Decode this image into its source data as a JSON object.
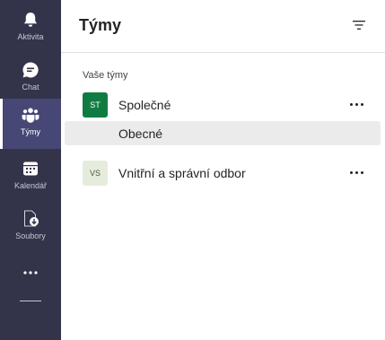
{
  "rail": {
    "items": [
      {
        "label": "Aktivita",
        "icon": "bell-icon"
      },
      {
        "label": "Chat",
        "icon": "chat-icon"
      },
      {
        "label": "Týmy",
        "icon": "teams-icon"
      },
      {
        "label": "Kalendář",
        "icon": "calendar-icon"
      },
      {
        "label": "Soubory",
        "icon": "files-icon"
      }
    ],
    "more_icon": "more-apps-icon"
  },
  "header": {
    "title": "Týmy",
    "filter_icon": "filter-icon"
  },
  "section_label": "Vaše týmy",
  "teams": [
    {
      "initials": "ST",
      "name": "Společné",
      "avatar_bg": "#107c41",
      "avatar_fg": "#ffffff",
      "channels": [
        {
          "name": "Obecné",
          "selected": true
        }
      ]
    },
    {
      "initials": "VS",
      "name": "Vnitřní a správní odbor",
      "avatar_bg": "#e6ecdc",
      "avatar_fg": "#4b5a3a",
      "channels": []
    }
  ],
  "colors": {
    "rail_bg": "#33344a",
    "rail_active": "#464775",
    "selected_channel_bg": "#ebebeb"
  }
}
